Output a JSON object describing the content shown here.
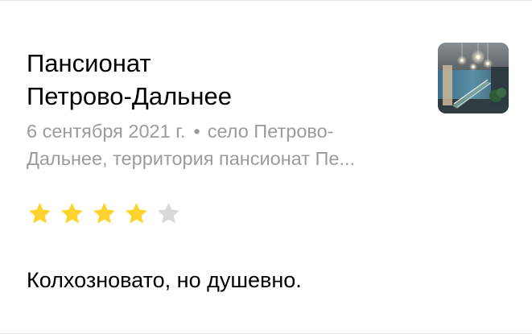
{
  "review_card": {
    "place_name_line1": "Пансионат",
    "place_name_line2": "Петрово-Дальнее",
    "date": "6 сентября 2021 г.",
    "separator": "•",
    "address_line1": "село Петрово-",
    "address_line2": "Дальнее, территория пансионат Пе...",
    "rating": {
      "value": 4,
      "max": 5
    },
    "review_text": "Колхозновато, но душевно.",
    "colors": {
      "star_filled": "#ffd22e",
      "star_empty": "#d9d9d9",
      "meta_text": "#9b9b9b"
    },
    "thumbnail": {
      "icon": "hotel-interior-photo"
    }
  }
}
